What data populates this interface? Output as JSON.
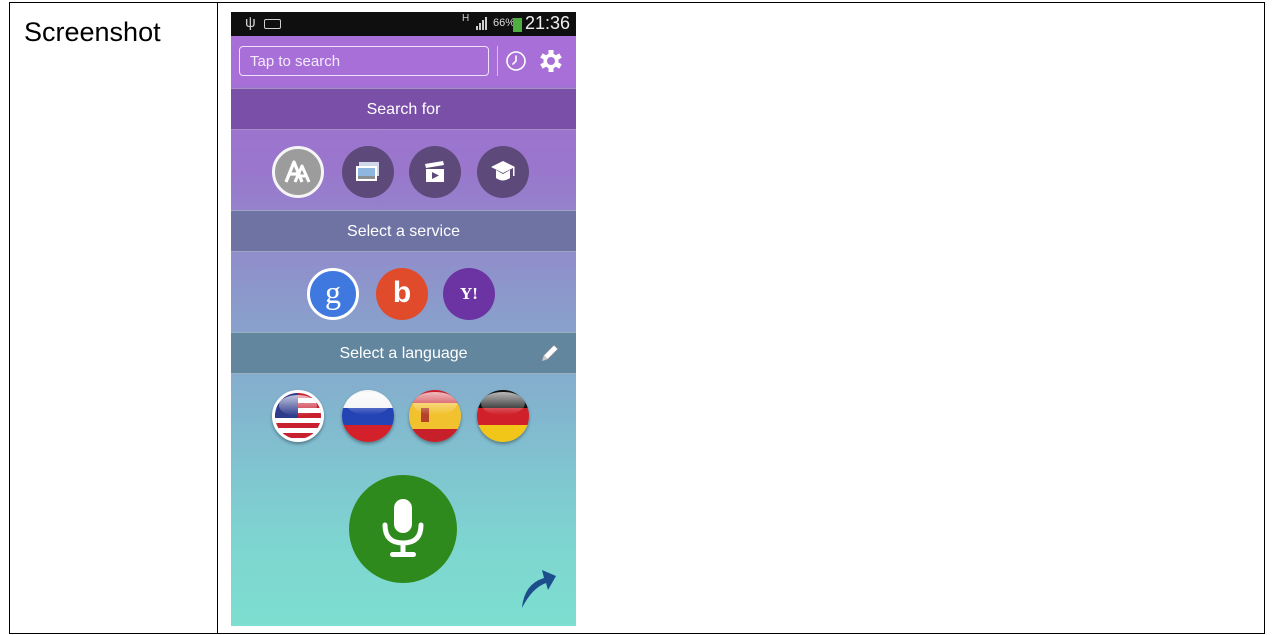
{
  "table": {
    "label": "Screenshot"
  },
  "status_bar": {
    "battery": "66%",
    "time": "21:36",
    "network": "H"
  },
  "search": {
    "placeholder": "Tap to search"
  },
  "sections": {
    "search_for": "Search for",
    "select_service": "Select a service",
    "select_language": "Select a language"
  },
  "categories": [
    {
      "icon": "text-a-icon",
      "selected": true
    },
    {
      "icon": "images-icon",
      "selected": false
    },
    {
      "icon": "video-clapper-icon",
      "selected": false
    },
    {
      "icon": "graduation-cap-icon",
      "selected": false
    }
  ],
  "services": [
    {
      "label": "g",
      "icon": "google-icon",
      "selected": true,
      "color": "#3f78df"
    },
    {
      "label": "b",
      "icon": "bing-icon",
      "selected": false,
      "color": "#e04b2c"
    },
    {
      "label": "Y!",
      "icon": "yahoo-icon",
      "selected": false,
      "color": "#6c33a3"
    }
  ],
  "languages": [
    {
      "icon": "us-flag-icon",
      "selected": true
    },
    {
      "icon": "russia-flag-icon",
      "selected": false
    },
    {
      "icon": "spain-flag-icon",
      "selected": false
    },
    {
      "icon": "germany-flag-icon",
      "selected": false
    }
  ],
  "colors": {
    "accent": "#a96fd8",
    "mic": "#2f8a1d"
  }
}
